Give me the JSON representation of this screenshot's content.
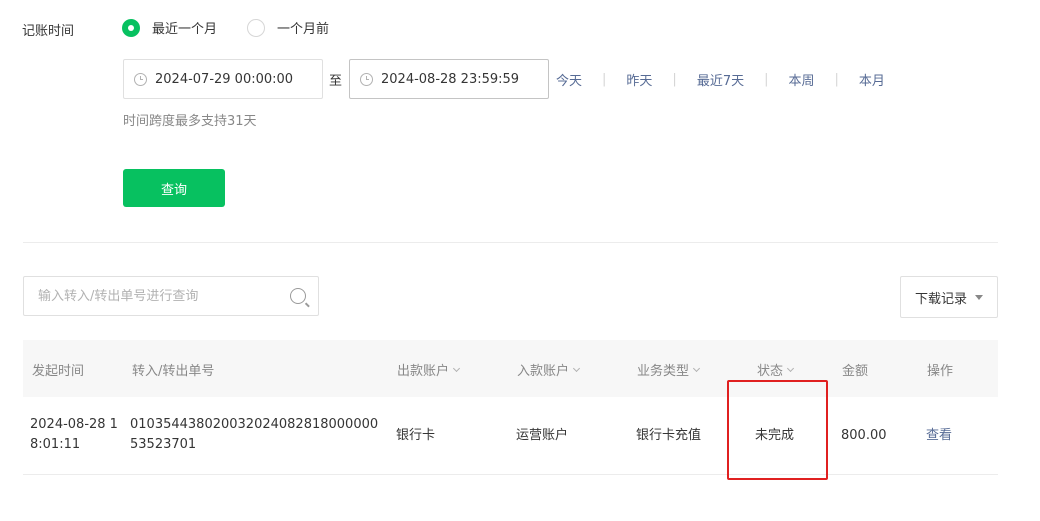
{
  "filter": {
    "label": "记账时间",
    "radio_options": [
      {
        "label": "最近一个月",
        "checked": true
      },
      {
        "label": "一个月前",
        "checked": false
      }
    ],
    "start_date": "2024-07-29 00:00:00",
    "to_label": "至",
    "end_date": "2024-08-28 23:59:59",
    "quick_ranges": [
      "今天",
      "昨天",
      "最近7天",
      "本周",
      "本月"
    ],
    "hint": "时间跨度最多支持31天",
    "query_button": "查询"
  },
  "toolbar": {
    "search_placeholder": "输入转入/转出单号进行查询",
    "download_label": "下载记录"
  },
  "table": {
    "columns": [
      "发起时间",
      "转入/转出单号",
      "出款账户",
      "入款账户",
      "业务类型",
      "状态",
      "金额",
      "操作"
    ],
    "rows": [
      {
        "time_line1": "2024-08-28 1",
        "time_line2": "8:01:11",
        "order_line1": "010354438020032024082818000000",
        "order_line2": "53523701",
        "from_account": "银行卡",
        "to_account": "运营账户",
        "biz_type": "银行卡充值",
        "status": "未完成",
        "amount": "800.00",
        "action": "查看"
      }
    ]
  },
  "colors": {
    "accent": "#07c160",
    "link": "#576b95",
    "highlight": "#e02020"
  }
}
